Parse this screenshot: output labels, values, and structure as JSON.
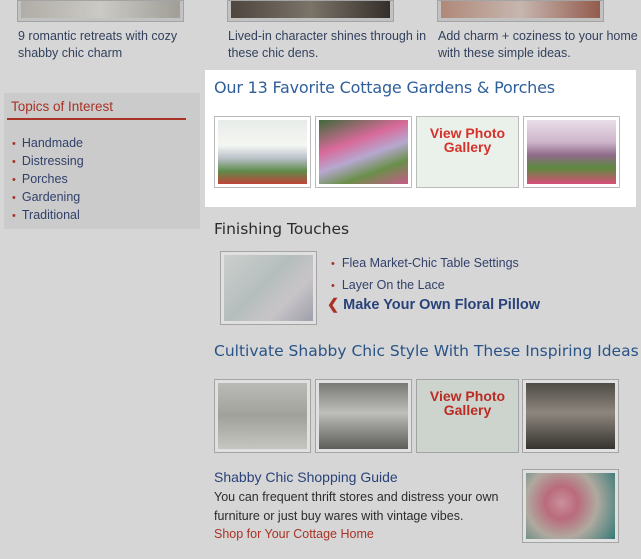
{
  "promos": [
    {
      "text": "9 romantic retreats with cozy shabby chic charm"
    },
    {
      "text": "Lived-in character shines through in these chic dens."
    },
    {
      "text": "Add charm + coziness to your home with these simple ideas."
    }
  ],
  "sidebar": {
    "title": "Topics of Interest",
    "items": [
      "Handmade",
      "Distressing",
      "Porches",
      "Gardening",
      "Traditional"
    ]
  },
  "featured": {
    "title": "Our 13 Favorite Cottage Gardens & Porches",
    "gallery_label": "View Photo Gallery"
  },
  "finishing": {
    "title": "Finishing Touches",
    "links": [
      "Flea Market-Chic Table Settings",
      "Layer On the Lace"
    ],
    "bold_link": "Make Your Own Floral Pillow"
  },
  "cultivate": {
    "title": "Cultivate Shabby Chic Style With These Inspiring Ideas",
    "gallery_label": "View Photo Gallery"
  },
  "shopping": {
    "title": "Shabby Chic Shopping Guide",
    "description": "You can frequent thrift stores and distress your own furniture or just buy wares with vintage vibes.",
    "link": "Shop for Your Cottage Home"
  },
  "colors": {
    "accent_red": "#c0392b",
    "link_blue": "#2f5f9a"
  }
}
